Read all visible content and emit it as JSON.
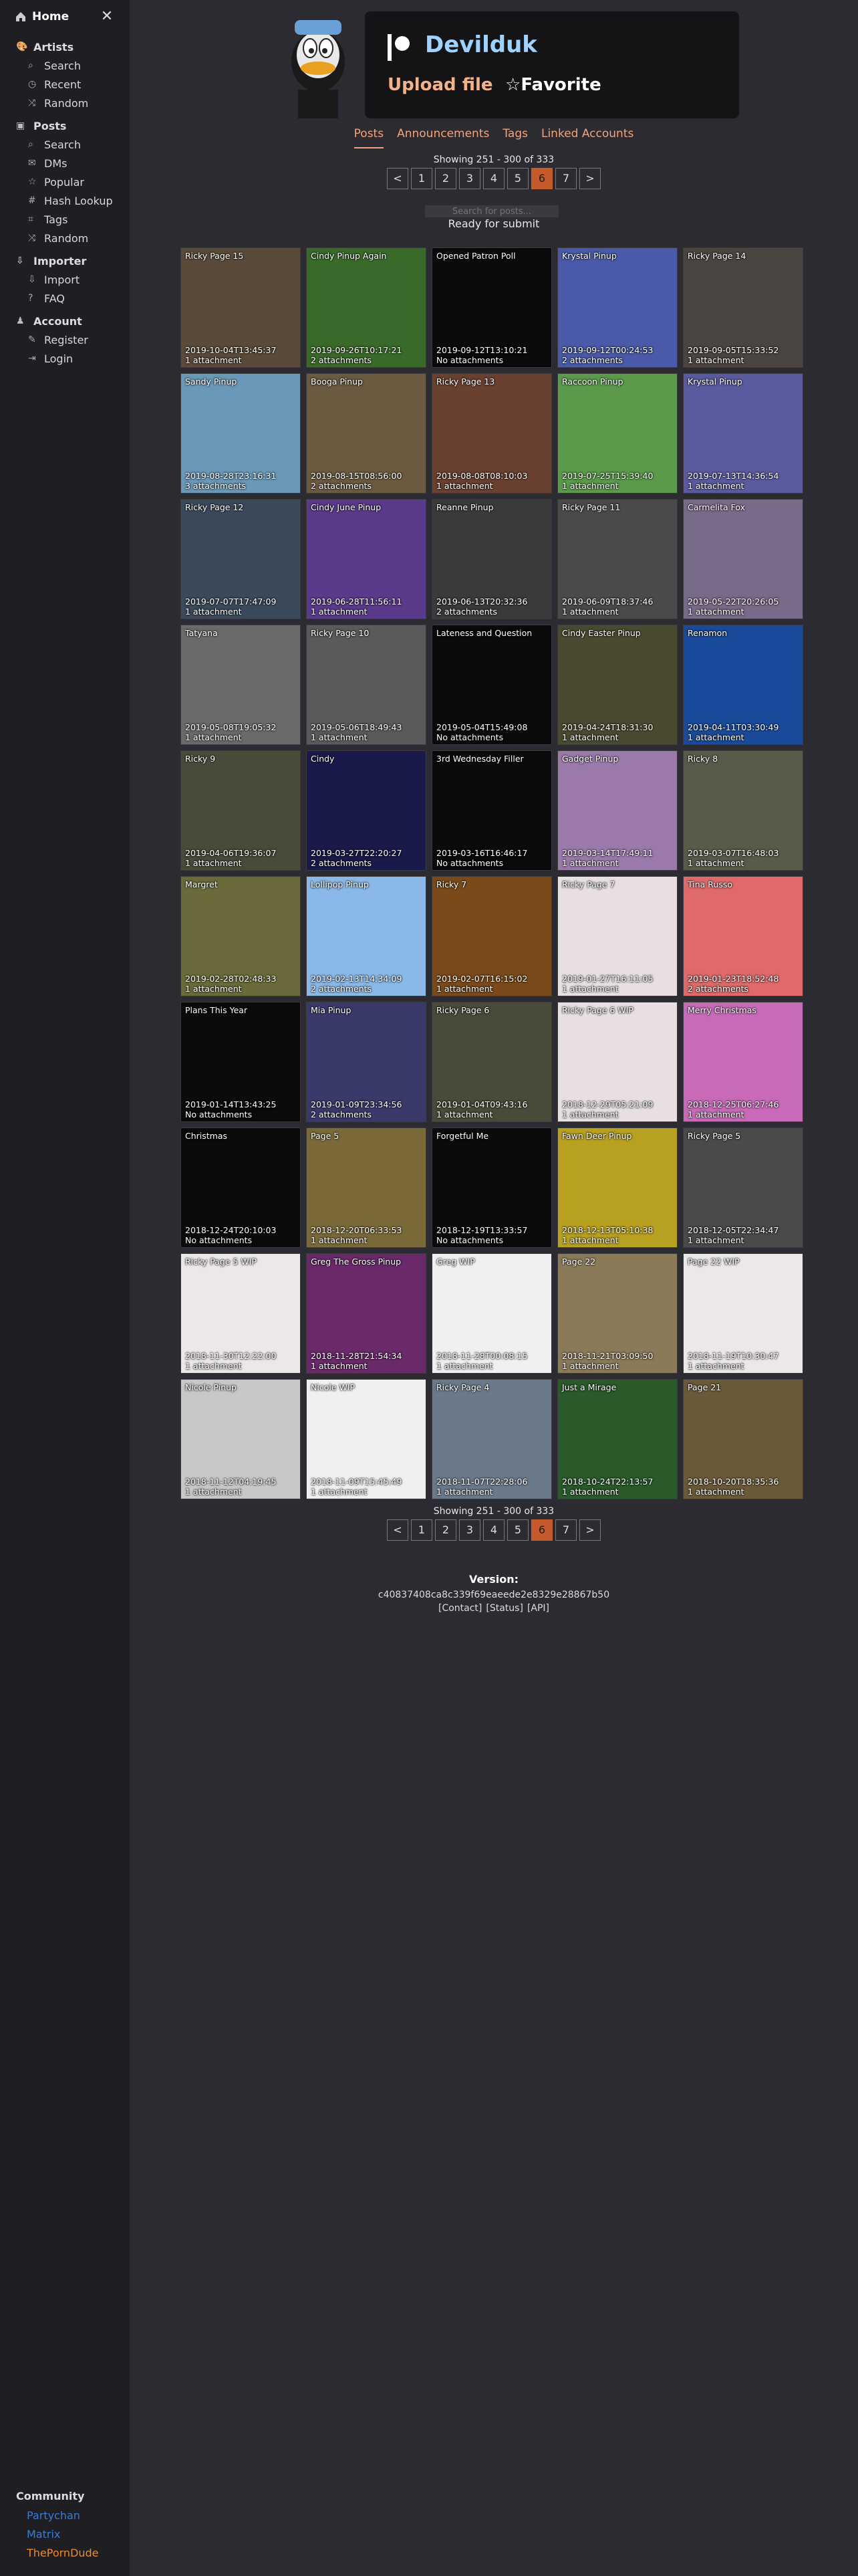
{
  "sidebar": {
    "home_label": "Home",
    "sections": [
      {
        "title": "Artists",
        "icon": "palette-icon",
        "items": [
          {
            "label": "Search",
            "icon": "search-icon"
          },
          {
            "label": "Recent",
            "icon": "clock-icon"
          },
          {
            "label": "Random",
            "icon": "shuffle-icon"
          }
        ]
      },
      {
        "title": "Posts",
        "icon": "image-icon",
        "items": [
          {
            "label": "Search",
            "icon": "search-icon"
          },
          {
            "label": "DMs",
            "icon": "message-icon"
          },
          {
            "label": "Popular",
            "icon": "star-icon"
          },
          {
            "label": "Hash Lookup",
            "icon": "hash-icon"
          },
          {
            "label": "Tags",
            "icon": "tag-icon"
          },
          {
            "label": "Random",
            "icon": "shuffle-icon"
          }
        ]
      },
      {
        "title": "Importer",
        "icon": "import-icon",
        "items": [
          {
            "label": "Import",
            "icon": "download-icon"
          },
          {
            "label": "FAQ",
            "icon": "faq-icon"
          }
        ]
      },
      {
        "title": "Account",
        "icon": "user-icon",
        "items": [
          {
            "label": "Register",
            "icon": "register-icon"
          },
          {
            "label": "Login",
            "icon": "login-icon"
          }
        ]
      }
    ],
    "community": {
      "title": "Community",
      "links": [
        {
          "label": "Partychan",
          "color": "#3a7bd5"
        },
        {
          "label": "Matrix",
          "color": "#3a7bd5"
        },
        {
          "label": "ThePornDude",
          "color": "#f08a24"
        }
      ]
    }
  },
  "header": {
    "name": "Devilduk",
    "upload_label": "Upload file",
    "favorite_label": "Favorite",
    "favorite_icon": "☆"
  },
  "tabs": [
    "Posts",
    "Announcements",
    "Tags",
    "Linked Accounts"
  ],
  "active_tab": 0,
  "pagination": {
    "showing_text": "Showing 251 - 300 of 333",
    "pages": [
      "<",
      "1",
      "2",
      "3",
      "4",
      "5",
      "6",
      "7",
      ">"
    ],
    "active": "6"
  },
  "search": {
    "placeholder": "Search for posts..."
  },
  "status": "Ready for submit",
  "posts": [
    {
      "title": "Ricky Page 15",
      "date": "2019-10-04T13:45:37",
      "att": "1 attachment",
      "bg": "#5a4a3a"
    },
    {
      "title": "Cindy Pinup Again",
      "date": "2019-09-26T10:17:21",
      "att": "2 attachments",
      "bg": "#3a6a2a"
    },
    {
      "title": "Opened Patron Poll",
      "date": "2019-09-12T13:10:21",
      "att": "No attachments",
      "bg": "#0a0a0a"
    },
    {
      "title": "Krystal Pinup",
      "date": "2019-09-12T00:24:53",
      "att": "2 attachments",
      "bg": "#4a5aa8"
    },
    {
      "title": "Ricky Page 14",
      "date": "2019-09-05T15:33:52",
      "att": "1 attachment",
      "bg": "#4a4540"
    },
    {
      "title": "Sandy Pinup",
      "date": "2019-08-28T23:16:31",
      "att": "3 attachments",
      "bg": "#6a98b8"
    },
    {
      "title": "Booga Pinup",
      "date": "2019-08-15T08:56:00",
      "att": "2 attachments",
      "bg": "#6a5a40"
    },
    {
      "title": "Ricky Page 13",
      "date": "2019-08-08T08:10:03",
      "att": "1 attachment",
      "bg": "#6a4030"
    },
    {
      "title": "Raccoon Pinup",
      "date": "2019-07-25T15:39:40",
      "att": "1 attachment",
      "bg": "#5a9a4a"
    },
    {
      "title": "Krystal Pinup",
      "date": "2019-07-13T14:36:54",
      "att": "1 attachment",
      "bg": "#5a5aa0"
    },
    {
      "title": "Ricky Page 12",
      "date": "2019-07-07T17:47:09",
      "att": "1 attachment",
      "bg": "#3a4a5a"
    },
    {
      "title": "Cindy June Pinup",
      "date": "2019-06-28T11:56:11",
      "att": "1 attachment",
      "bg": "#5a3a8a"
    },
    {
      "title": "Reanne Pinup",
      "date": "2019-06-13T20:32:36",
      "att": "2 attachments",
      "bg": "#3a3a3a"
    },
    {
      "title": "Ricky Page 11",
      "date": "2019-06-09T18:37:46",
      "att": "1 attachment",
      "bg": "#4a4a4a"
    },
    {
      "title": "Carmelita Fox",
      "date": "2019-05-22T20:26:05",
      "att": "1 attachment",
      "bg": "#7a6a8a"
    },
    {
      "title": "Tatyana",
      "date": "2019-05-08T19:05:32",
      "att": "1 attachment",
      "bg": "#6a6a6a"
    },
    {
      "title": "Ricky Page 10",
      "date": "2019-05-06T18:49:43",
      "att": "1 attachment",
      "bg": "#5a5a5a"
    },
    {
      "title": "Lateness and Question",
      "date": "2019-05-04T15:49:08",
      "att": "No attachments",
      "bg": "#0a0a0a"
    },
    {
      "title": "Cindy Easter Pinup",
      "date": "2019-04-24T18:31:30",
      "att": "1 attachment",
      "bg": "#4a4a30"
    },
    {
      "title": "Renamon",
      "date": "2019-04-11T03:30:49",
      "att": "1 attachment",
      "bg": "#1a4a9a"
    },
    {
      "title": "Ricky 9",
      "date": "2019-04-06T19:36:07",
      "att": "1 attachment",
      "bg": "#4a4a3a"
    },
    {
      "title": "Cindy",
      "date": "2019-03-27T22:20:27",
      "att": "2 attachments",
      "bg": "#1a1a4a"
    },
    {
      "title": "3rd Wednesday Filler",
      "date": "2019-03-16T16:46:17",
      "att": "No attachments",
      "bg": "#0a0a0a"
    },
    {
      "title": "Gadget Pinup",
      "date": "2019-03-14T17:49:11",
      "att": "1 attachment",
      "bg": "#9a7aaa"
    },
    {
      "title": "Ricky 8",
      "date": "2019-03-07T16:48:03",
      "att": "1 attachment",
      "bg": "#5a5a4a"
    },
    {
      "title": "Margret",
      "date": "2019-02-28T02:48:33",
      "att": "1 attachment",
      "bg": "#6a6a3a"
    },
    {
      "title": "Lollipop Pinup",
      "date": "2019-02-13T14:34:09",
      "att": "2 attachments",
      "bg": "#8ab8e8"
    },
    {
      "title": "Ricky 7",
      "date": "2019-02-07T16:15:02",
      "att": "1 attachment",
      "bg": "#7a4a1a"
    },
    {
      "title": "Ricky Page 7",
      "date": "2019-01-27T16:11:05",
      "att": "1 attachment",
      "bg": "#e8e0e0"
    },
    {
      "title": "Tina Russo",
      "date": "2019-01-23T18:52:48",
      "att": "2 attachments",
      "bg": "#e06a6a"
    },
    {
      "title": "Plans This Year",
      "date": "2019-01-14T13:43:25",
      "att": "No attachments",
      "bg": "#0a0a0a"
    },
    {
      "title": "Mia Pinup",
      "date": "2019-01-09T23:34:56",
      "att": "2 attachments",
      "bg": "#3a3a6a"
    },
    {
      "title": "Ricky Page 6",
      "date": "2019-01-04T09:43:16",
      "att": "1 attachment",
      "bg": "#4a4a3a"
    },
    {
      "title": "Ricky Page 6 WIP",
      "date": "2018-12-29T05:21:09",
      "att": "1 attachment",
      "bg": "#e8e0e0"
    },
    {
      "title": "Merry Christmas",
      "date": "2018-12-25T06:27:46",
      "att": "1 attachment",
      "bg": "#c86ab8"
    },
    {
      "title": "Christmas",
      "date": "2018-12-24T20:10:03",
      "att": "No attachments",
      "bg": "#0a0a0a"
    },
    {
      "title": "Page 5",
      "date": "2018-12-20T06:33:53",
      "att": "1 attachment",
      "bg": "#7a6a3a"
    },
    {
      "title": "Forgetful Me",
      "date": "2018-12-19T13:33:57",
      "att": "No attachments",
      "bg": "#0a0a0a"
    },
    {
      "title": "Fawn Deer Pinup",
      "date": "2018-12-13T05:10:38",
      "att": "1 attachment",
      "bg": "#b8a020"
    },
    {
      "title": "Ricky Page 5",
      "date": "2018-12-05T22:34:47",
      "att": "1 attachment",
      "bg": "#4a4a4a"
    },
    {
      "title": "Ricky Page 5 WIP",
      "date": "2018-11-30T12:22:00",
      "att": "1 attachment",
      "bg": "#ece8e8"
    },
    {
      "title": "Greg The Gross Pinup",
      "date": "2018-11-28T21:54:34",
      "att": "1 attachment",
      "bg": "#6a2a6a"
    },
    {
      "title": "Greg WIP",
      "date": "2018-11-28T00:08:15",
      "att": "1 attachment",
      "bg": "#f0f0f0"
    },
    {
      "title": "Page 22",
      "date": "2018-11-21T03:09:50",
      "att": "1 attachment",
      "bg": "#8a7a5a"
    },
    {
      "title": "Page 22 WIP",
      "date": "2018-11-19T10:30:47",
      "att": "1 attachment",
      "bg": "#ece8e8"
    },
    {
      "title": "Nicole Pinup",
      "date": "2018-11-12T04:19:45",
      "att": "1 attachment",
      "bg": "#c8c8c8"
    },
    {
      "title": "Nicole WIP",
      "date": "2018-11-09T15:45:49",
      "att": "1 attachment",
      "bg": "#f0f0f0"
    },
    {
      "title": "Ricky Page 4",
      "date": "2018-11-07T22:28:06",
      "att": "1 attachment",
      "bg": "#6a7a8a"
    },
    {
      "title": "Just a Mirage",
      "date": "2018-10-24T22:13:57",
      "att": "1 attachment",
      "bg": "#2a5a2a"
    },
    {
      "title": "Page 21",
      "date": "2018-10-20T18:35:36",
      "att": "1 attachment",
      "bg": "#6a5a3a"
    }
  ],
  "footer": {
    "version_label": "Version:",
    "hash": "c40837408ca8c339f69eaeede2e8329e28867b50",
    "links": [
      "[Contact]",
      "[Status]",
      "[API]"
    ]
  }
}
